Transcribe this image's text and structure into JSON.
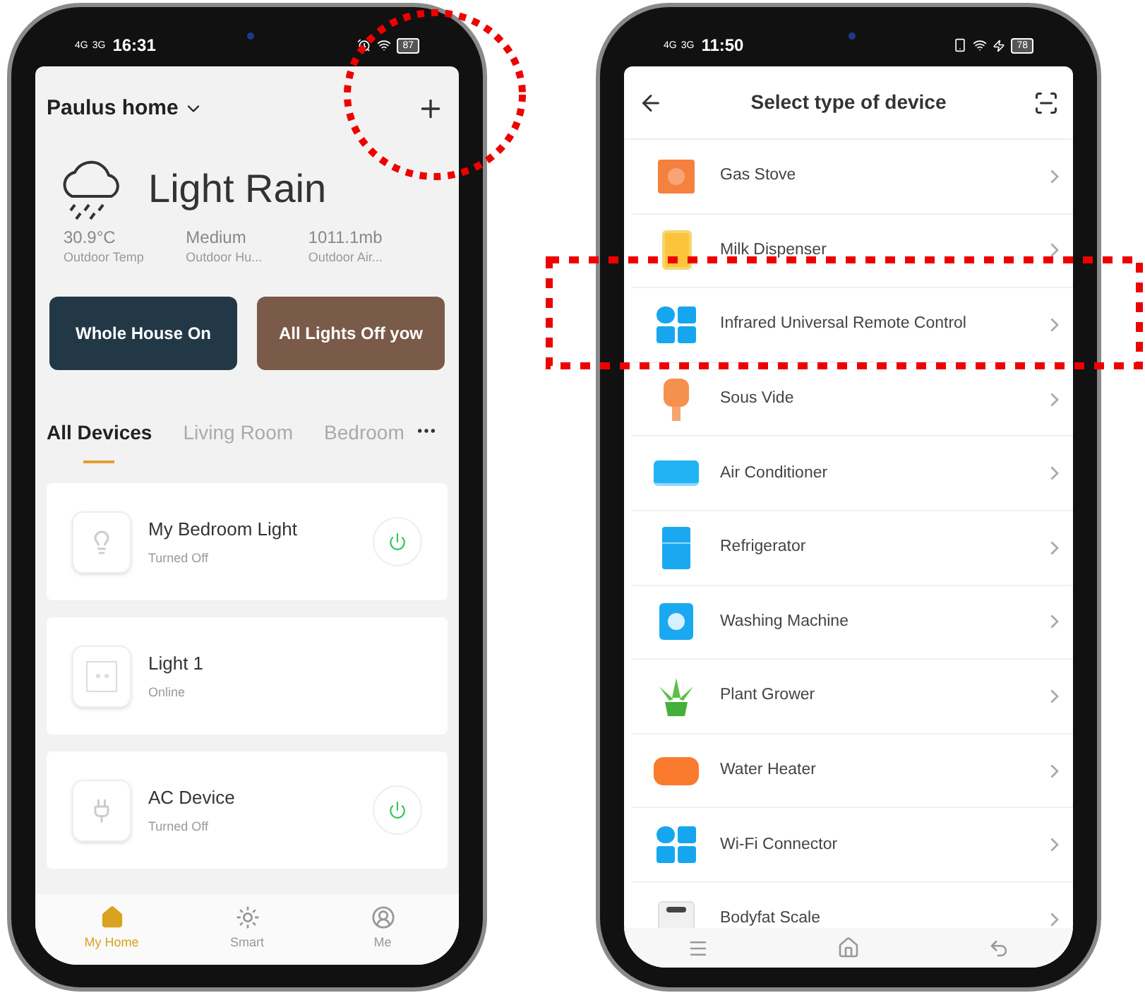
{
  "home_screen": {
    "status_bar": {
      "network_1": "4G",
      "network_2": "3G",
      "time": "16:31",
      "battery": "87"
    },
    "home_name": "Paulus home",
    "weather": {
      "condition": "Light Rain",
      "stats": [
        {
          "value": "30.9°C",
          "label": "Outdoor Temp"
        },
        {
          "value": "Medium",
          "label": "Outdoor Hu..."
        },
        {
          "value": "1011.1mb",
          "label": "Outdoor Air..."
        }
      ]
    },
    "scenes": [
      {
        "label": "Whole House On"
      },
      {
        "label": "All Lights Off yow"
      }
    ],
    "tabs": [
      {
        "label": "All Devices",
        "selected": true
      },
      {
        "label": "Living Room",
        "selected": false
      },
      {
        "label": "Bedroom",
        "selected": false
      }
    ],
    "devices": [
      {
        "kind": "bulb",
        "name": "My Bedroom Light",
        "status": "Turned Off",
        "power_button": true
      },
      {
        "kind": "socket",
        "name": "Light 1",
        "status": "Online",
        "power_button": false
      },
      {
        "kind": "plug",
        "name": "AC Device",
        "status": "Turned Off",
        "power_button": true
      }
    ],
    "bottom_nav": [
      {
        "kind": "home",
        "label": "My Home",
        "selected": true
      },
      {
        "kind": "smart",
        "label": "Smart",
        "selected": false
      },
      {
        "kind": "me",
        "label": "Me",
        "selected": false
      }
    ]
  },
  "device_type_screen": {
    "status_bar": {
      "network_1": "4G",
      "network_2": "3G",
      "time": "11:50",
      "battery": "78"
    },
    "title": "Select type of device",
    "device_types": [
      {
        "kind": "stove",
        "label": "Gas Stove"
      },
      {
        "kind": "dispenser",
        "label": "Milk Dispenser"
      },
      {
        "kind": "tiles",
        "label": "Infrared Universal Remote Control"
      },
      {
        "kind": "sousvide",
        "label": "Sous Vide"
      },
      {
        "kind": "ac",
        "label": "Air Conditioner"
      },
      {
        "kind": "fridge",
        "label": "Refrigerator"
      },
      {
        "kind": "washer",
        "label": "Washing Machine"
      },
      {
        "kind": "plant",
        "label": "Plant Grower"
      },
      {
        "kind": "heater",
        "label": "Water Heater"
      },
      {
        "kind": "tiles",
        "label": "Wi-Fi Connector"
      },
      {
        "kind": "scale",
        "label": "Bodyfat Scale"
      }
    ]
  }
}
